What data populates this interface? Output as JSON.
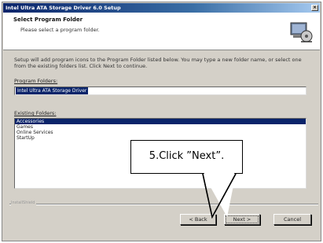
{
  "window": {
    "title": "Intel Ultra ATA Storage Driver 6.0 Setup",
    "close_glyph": "×"
  },
  "header": {
    "title": "Select Program Folder",
    "subtitle": "Please select a program folder."
  },
  "body": {
    "description": "Setup will add program icons to the Program Folder listed below. You may type a new folder name, or select one from the existing folders list. Click Next to continue.",
    "program_folder_label": "Program Folders:",
    "program_folder_value": "Intel Ultra ATA Storage Driver",
    "existing_folders_label": "Existing Folders:",
    "existing_folders": [
      {
        "label": "Accessories",
        "selected": true
      },
      {
        "label": "Games",
        "selected": false
      },
      {
        "label": "Online Services",
        "selected": false
      },
      {
        "label": "StartUp",
        "selected": false
      }
    ]
  },
  "footer": {
    "group_label": "InstallShield",
    "back_label": "< Back",
    "next_label": "Next >",
    "cancel_label": "Cancel"
  },
  "callout": {
    "text": "5.Click ”Next”."
  },
  "colors": {
    "selection": "#0a246a",
    "dialog_face": "#d4d0c8"
  }
}
